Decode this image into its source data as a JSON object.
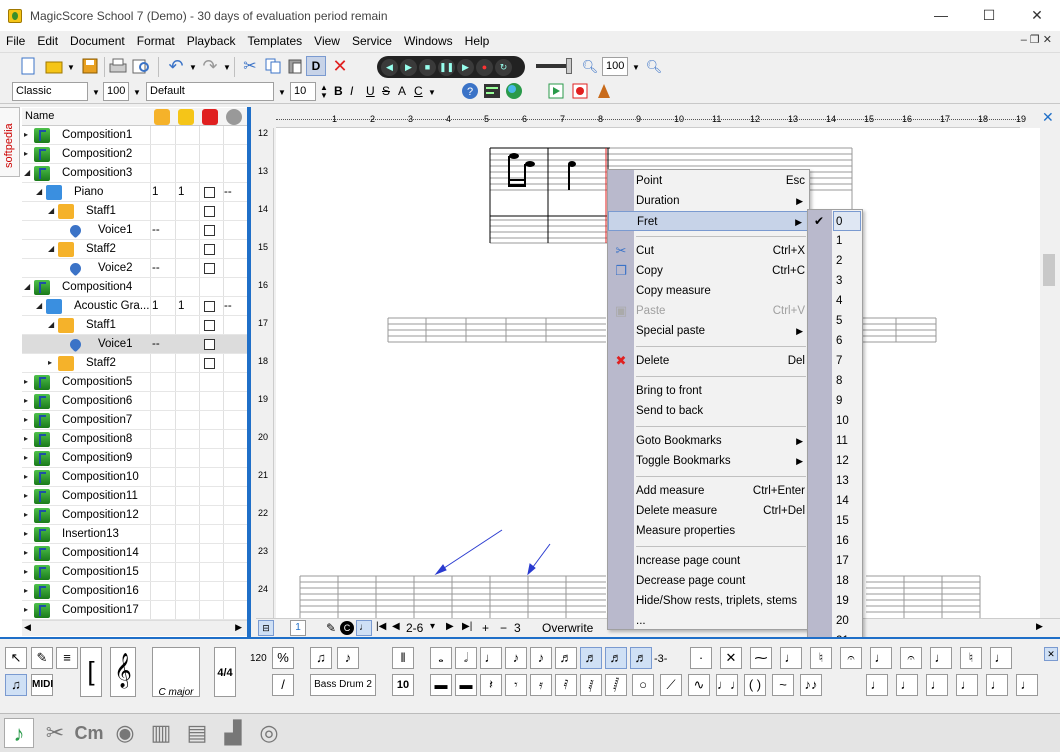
{
  "window": {
    "title": "MagicScore School 7 (Demo) - 30 days of evaluation period remain",
    "minimize": "—",
    "maximize": "☐",
    "close": "✕"
  },
  "menu": [
    "File",
    "Edit",
    "Document",
    "Format",
    "Playback",
    "Templates",
    "View",
    "Service",
    "Windows",
    "Help"
  ],
  "mdi_controls": "–  ❐  ✕",
  "toolbar": {
    "zoom_value": "100",
    "style_combo": "Classic",
    "size_combo": "100",
    "font_combo": "Default",
    "fontsize_combo": "10",
    "format_letters": [
      "B",
      "I",
      "U",
      "S",
      "A",
      "C"
    ],
    "d_button": "D"
  },
  "sidebar_tab": "softpedia",
  "tree": {
    "header_name": "Name",
    "rows": [
      {
        "label": "Composition1",
        "indent": 0,
        "type": "comp",
        "exp": "▸"
      },
      {
        "label": "Composition2",
        "indent": 0,
        "type": "comp",
        "exp": "▸"
      },
      {
        "label": "Composition3",
        "indent": 0,
        "type": "comp",
        "exp": "◢"
      },
      {
        "label": "Piano",
        "indent": 1,
        "type": "instr",
        "exp": "◢",
        "c1": "1",
        "c2": "1",
        "cb": true,
        "c4": "--"
      },
      {
        "label": "Staff1",
        "indent": 2,
        "type": "staff",
        "exp": "◢",
        "cb": true
      },
      {
        "label": "Voice1",
        "indent": 3,
        "type": "voice",
        "exp": "",
        "c1": "--",
        "cb": true
      },
      {
        "label": "Staff2",
        "indent": 2,
        "type": "staff",
        "exp": "◢",
        "cb": true
      },
      {
        "label": "Voice2",
        "indent": 3,
        "type": "voice",
        "exp": "",
        "c1": "--",
        "cb": true
      },
      {
        "label": "Composition4",
        "indent": 0,
        "type": "comp",
        "exp": "◢"
      },
      {
        "label": "Acoustic Gra...",
        "indent": 1,
        "type": "instr",
        "exp": "◢",
        "c1": "1",
        "c2": "1",
        "cb": true,
        "c4": "--"
      },
      {
        "label": "Staff1",
        "indent": 2,
        "type": "staff",
        "exp": "◢",
        "cb": true
      },
      {
        "label": "Voice1",
        "indent": 3,
        "type": "voice",
        "exp": "",
        "c1": "--",
        "cb": true,
        "selected": true
      },
      {
        "label": "Staff2",
        "indent": 2,
        "type": "staff",
        "exp": "▸",
        "cb": true
      },
      {
        "label": "Composition5",
        "indent": 0,
        "type": "comp",
        "exp": "▸"
      },
      {
        "label": "Composition6",
        "indent": 0,
        "type": "comp",
        "exp": "▸"
      },
      {
        "label": "Composition7",
        "indent": 0,
        "type": "comp",
        "exp": "▸"
      },
      {
        "label": "Composition8",
        "indent": 0,
        "type": "comp",
        "exp": "▸"
      },
      {
        "label": "Composition9",
        "indent": 0,
        "type": "comp",
        "exp": "▸"
      },
      {
        "label": "Composition10",
        "indent": 0,
        "type": "comp",
        "exp": "▸"
      },
      {
        "label": "Composition11",
        "indent": 0,
        "type": "comp",
        "exp": "▸"
      },
      {
        "label": "Composition12",
        "indent": 0,
        "type": "comp",
        "exp": "▸"
      },
      {
        "label": "Insertion13",
        "indent": 0,
        "type": "comp",
        "exp": "▸"
      },
      {
        "label": "Composition14",
        "indent": 0,
        "type": "comp",
        "exp": "▸"
      },
      {
        "label": "Composition15",
        "indent": 0,
        "type": "comp",
        "exp": "▸"
      },
      {
        "label": "Composition16",
        "indent": 0,
        "type": "comp",
        "exp": "▸"
      },
      {
        "label": "Composition17",
        "indent": 0,
        "type": "comp",
        "exp": "▸"
      }
    ]
  },
  "ruler_top": [
    "1",
    "2",
    "3",
    "4",
    "5",
    "6",
    "7",
    "8",
    "9",
    "10",
    "11",
    "12",
    "13",
    "14",
    "15",
    "16",
    "17",
    "18",
    "19"
  ],
  "ruler_left": [
    "12",
    "13",
    "14",
    "15",
    "16",
    "17",
    "18",
    "19",
    "20",
    "21",
    "22",
    "23",
    "24"
  ],
  "status": {
    "page_num": "1",
    "range": "2-6",
    "count": "3",
    "mode": "Overwrite"
  },
  "context_menu": {
    "items": [
      {
        "label": "Point",
        "shortcut": "Esc"
      },
      {
        "label": "Duration",
        "sub": true
      },
      {
        "label": "Fret",
        "sub": true,
        "highlight": true
      },
      {
        "sep": true
      },
      {
        "label": "Cut",
        "shortcut": "Ctrl+X",
        "icon": "cut"
      },
      {
        "label": "Copy",
        "shortcut": "Ctrl+C",
        "icon": "copy"
      },
      {
        "label": "Copy measure"
      },
      {
        "label": "Paste",
        "shortcut": "Ctrl+V",
        "disabled": true,
        "icon": "paste"
      },
      {
        "label": "Special paste",
        "sub": true
      },
      {
        "sep": true
      },
      {
        "label": "Delete",
        "shortcut": "Del",
        "icon": "delete"
      },
      {
        "sep": true
      },
      {
        "label": "Bring to front"
      },
      {
        "label": "Send to back"
      },
      {
        "sep": true
      },
      {
        "label": "Goto Bookmarks",
        "sub": true
      },
      {
        "label": "Toggle Bookmarks",
        "sub": true
      },
      {
        "sep": true
      },
      {
        "label": "Add measure",
        "shortcut": "Ctrl+Enter"
      },
      {
        "label": "Delete measure",
        "shortcut": "Ctrl+Del"
      },
      {
        "label": "Measure properties"
      },
      {
        "sep": true
      },
      {
        "label": "Increase page count"
      },
      {
        "label": "Decrease page count"
      },
      {
        "label": "Hide/Show rests, triplets, stems ..."
      }
    ]
  },
  "fret_submenu": [
    "0",
    "1",
    "2",
    "3",
    "4",
    "5",
    "6",
    "7",
    "8",
    "9",
    "10",
    "11",
    "12",
    "13",
    "14",
    "15",
    "16",
    "17",
    "18",
    "19",
    "20",
    "21",
    "22",
    "23"
  ],
  "palette": {
    "key_label": "C major",
    "time_sig": "4/4",
    "drum_label": "Bass Drum 2",
    "midi": "MIDI",
    "tuplet": "-3-",
    "num_120": "120",
    "ten": "10"
  },
  "colors": {
    "accent": "#1f6fc8",
    "menu_gutter": "#b9b9cc",
    "highlight": "#c7d3e8"
  }
}
